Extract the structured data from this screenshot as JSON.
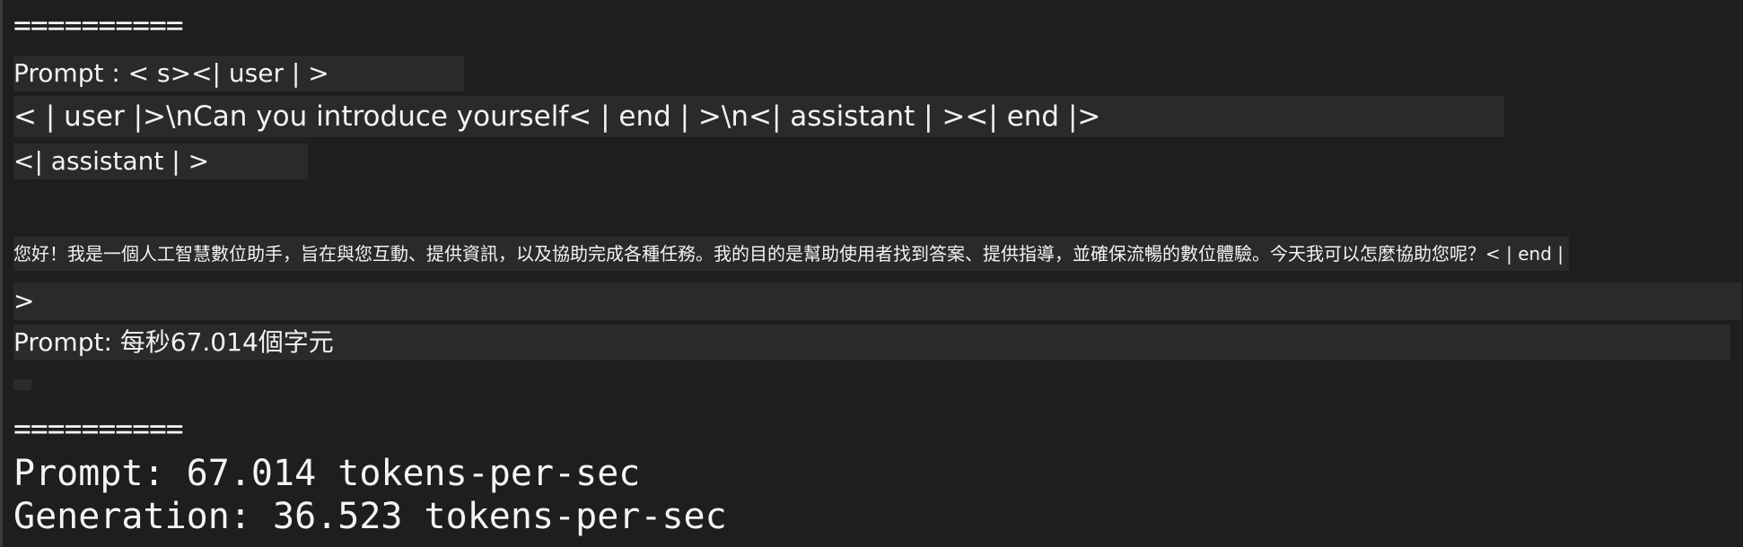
{
  "terminal": {
    "separator_top": "==========",
    "prompt_header": "Prompt : < s><| user | >",
    "user_message": "< | user |>\\nCan you introduce yourself< | end | >\\n<| assistant | ><| end |>",
    "assistant_tag": "<| assistant | >",
    "response": "您好！我是一個人工智慧數位助手，旨在與您互動、提供資訊，以及協助完成各種任務。我的目的是幫助使用者找到答案、提供指導，並確保流暢的數位體驗。今天我可以怎麼協助您呢？< | end |",
    "response_continuation": ">",
    "prompt_rate_zh": "Prompt: 每秒67.014個字元",
    "separator_bottom": "==========",
    "prompt_rate": "Prompt: 67.014 tokens-per-sec",
    "generation_rate": "Generation: 36.523 tokens-per-sec"
  }
}
